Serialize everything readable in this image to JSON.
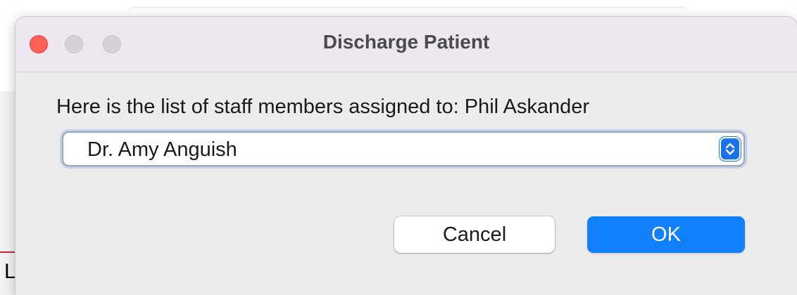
{
  "background": {
    "partial_text": "L",
    "accent_line_color": "#cc2a2a"
  },
  "dialog": {
    "title": "Discharge Patient",
    "window_controls": [
      "close-icon",
      "minimize-icon",
      "zoom-icon"
    ],
    "message": "Here is the list of staff members assigned to: Phil Askander",
    "staff_select": {
      "selected_value": "Dr. Amy Anguish",
      "icon": "updown-chevron-icon"
    },
    "buttons": {
      "cancel_label": "Cancel",
      "ok_label": "OK"
    },
    "colors": {
      "close": "#fe5f57",
      "accent": "#1081fb"
    }
  }
}
